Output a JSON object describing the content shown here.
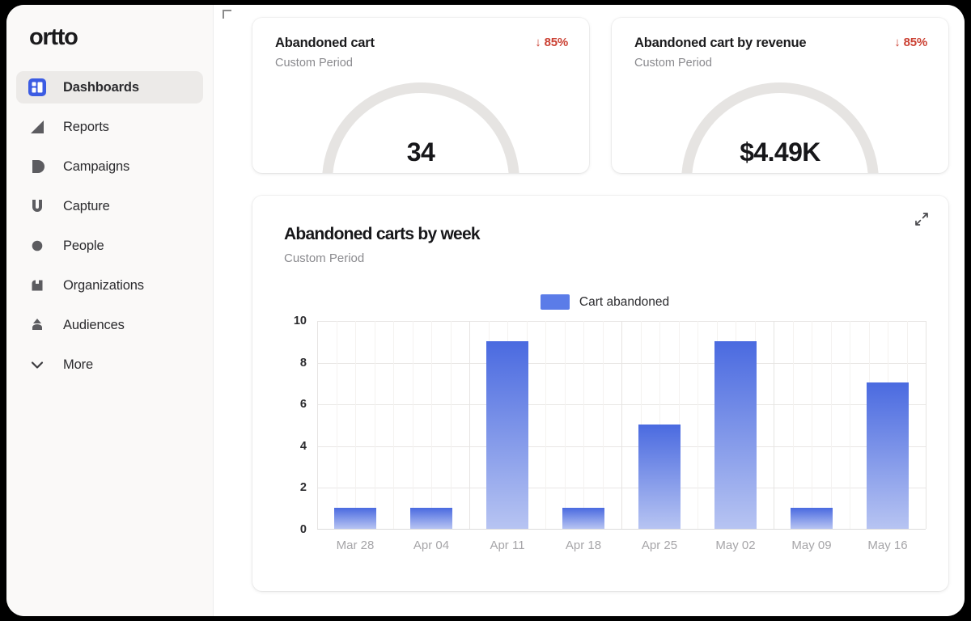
{
  "app": {
    "logo": "ortto"
  },
  "sidebar": {
    "items": [
      {
        "label": "Dashboards",
        "icon": "dashboard-icon",
        "active": true
      },
      {
        "label": "Reports",
        "icon": "reports-icon",
        "active": false
      },
      {
        "label": "Campaigns",
        "icon": "campaigns-icon",
        "active": false
      },
      {
        "label": "Capture",
        "icon": "capture-icon",
        "active": false
      },
      {
        "label": "People",
        "icon": "people-icon",
        "active": false
      },
      {
        "label": "Organizations",
        "icon": "organizations-icon",
        "active": false
      },
      {
        "label": "Audiences",
        "icon": "audiences-icon",
        "active": false
      },
      {
        "label": "More",
        "icon": "chevron-down-icon",
        "active": false
      }
    ]
  },
  "stat_cards": [
    {
      "title": "Abandoned cart",
      "subtitle": "Custom Period",
      "delta": "↓ 85%",
      "delta_direction": "down",
      "delta_color": "#cb4133",
      "value": "34"
    },
    {
      "title": "Abandoned cart by revenue",
      "subtitle": "Custom Period",
      "delta": "↓ 85%",
      "delta_direction": "down",
      "delta_color": "#cb4133",
      "value": "$4.49K"
    }
  ],
  "chart_card": {
    "title": "Abandoned carts by week",
    "subtitle": "Custom Period",
    "expand_icon": "expand-diagonal-icon"
  },
  "chart_data": {
    "type": "bar",
    "title": "Abandoned carts by week",
    "subtitle": "Custom Period",
    "xlabel": "",
    "ylabel": "",
    "categories": [
      "Mar 28",
      "Apr 04",
      "Apr 11",
      "Apr 18",
      "Apr 25",
      "May 02",
      "May 09",
      "May 16"
    ],
    "series": [
      {
        "name": "Cart abandoned",
        "values": [
          1,
          1,
          9,
          1,
          5,
          9,
          1,
          7
        ]
      }
    ],
    "yticks": [
      0,
      2,
      4,
      6,
      8,
      10
    ],
    "ylim": [
      0,
      10
    ],
    "grid": true,
    "legend_position": "top-center",
    "legend": [
      "Cart abandoned"
    ],
    "bar_color_top": "#4a6ae0",
    "bar_color_bottom": "#b7c4f2",
    "legend_swatch_color": "#5b7ce8"
  },
  "colors": {
    "accent": "#3c5ce3",
    "sidebar_bg": "#faf9f8",
    "card_bg": "#ffffff",
    "gauge_track": "#e6e4e2"
  }
}
